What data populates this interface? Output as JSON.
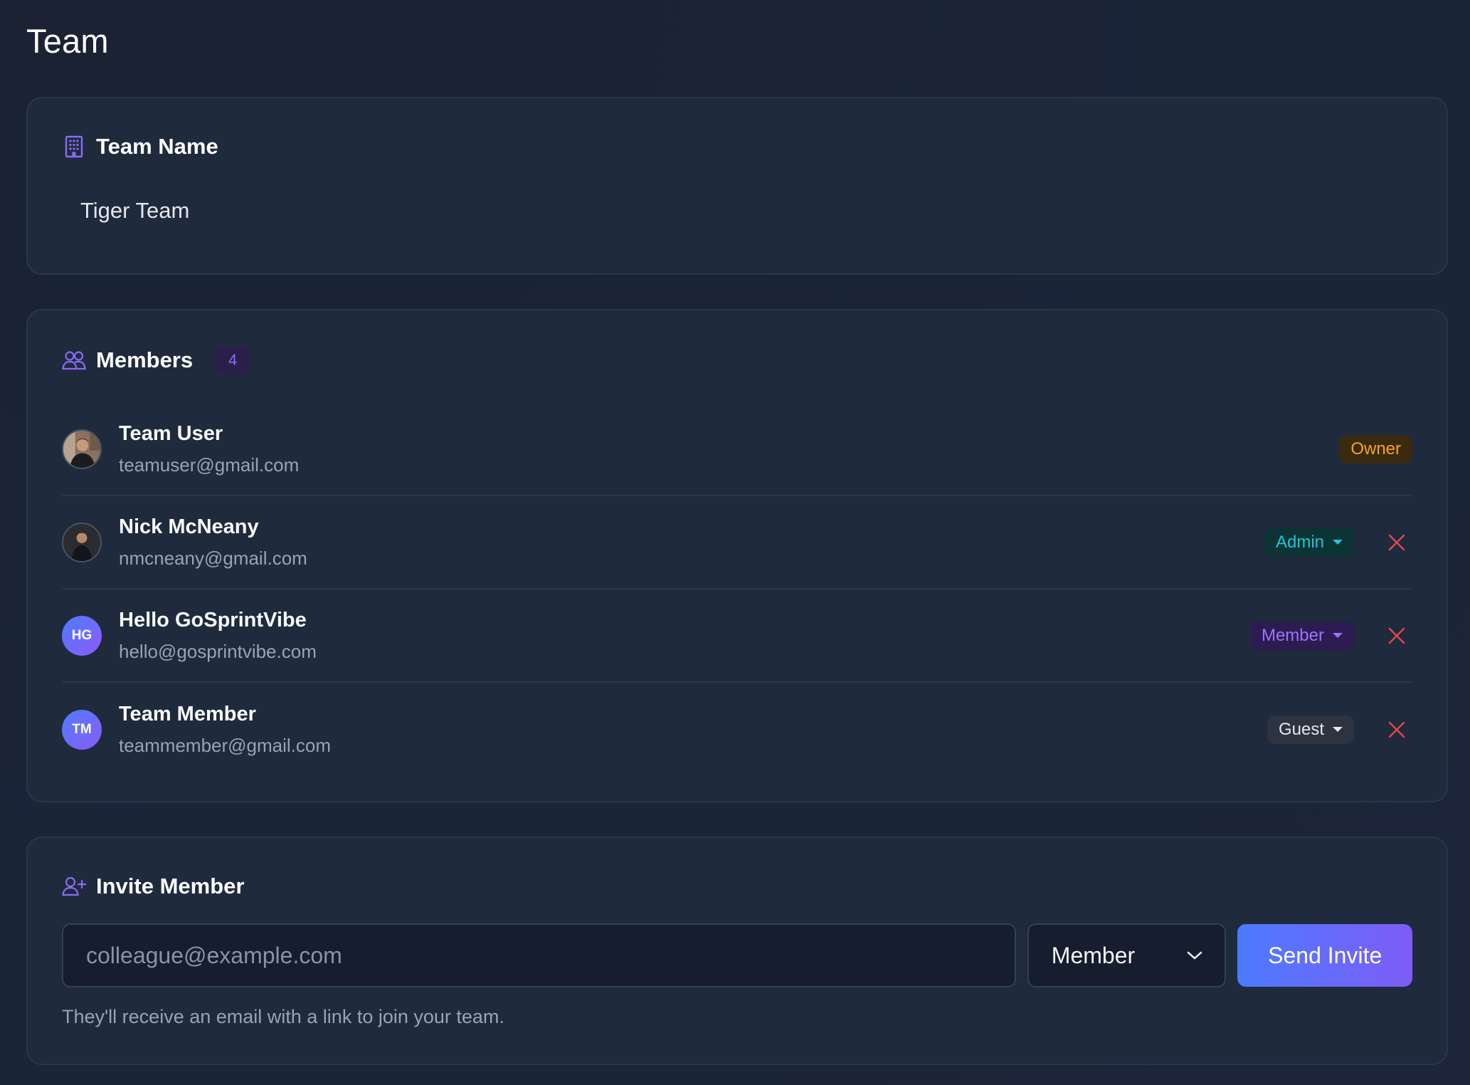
{
  "page": {
    "title": "Team"
  },
  "team_name": {
    "heading": "Team Name",
    "value": "Tiger Team"
  },
  "members": {
    "heading": "Members",
    "count": "4",
    "items": [
      {
        "name": "Team User",
        "email": "teamuser@gmail.com",
        "role": "Owner",
        "avatar": "photo"
      },
      {
        "name": "Nick McNeany",
        "email": "nmcneany@gmail.com",
        "role": "Admin",
        "avatar": "photo"
      },
      {
        "name": "Hello GoSprintVibe",
        "email": "hello@gosprintvibe.com",
        "role": "Member",
        "avatar": "HG"
      },
      {
        "name": "Team Member",
        "email": "teammember@gmail.com",
        "role": "Guest",
        "avatar": "TM"
      }
    ]
  },
  "invite": {
    "heading": "Invite Member",
    "email_placeholder": "colleague@example.com",
    "role_selected": "Member",
    "send_label": "Send Invite",
    "hint": "They'll receive an email with a link to join your team."
  },
  "colors": {
    "accent": "#8b6cf5",
    "owner": "#f5a524",
    "admin": "#22c4d8",
    "member": "#9d73ff",
    "remove": "#e5484d"
  }
}
